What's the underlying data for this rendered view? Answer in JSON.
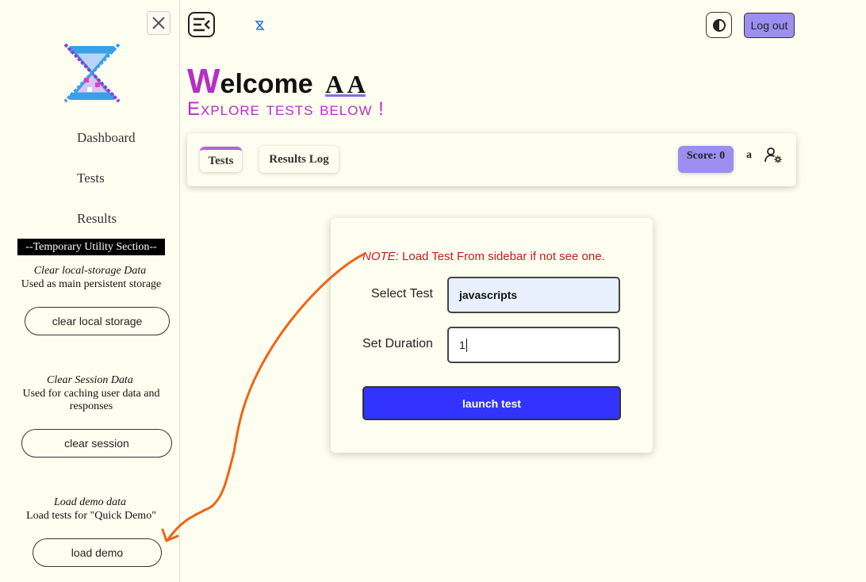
{
  "sidebar": {
    "nav": [
      {
        "label": "Dashboard"
      },
      {
        "label": "Tests"
      },
      {
        "label": "Results"
      }
    ],
    "utility_header": "--Temporary Utility Section--",
    "local_storage": {
      "title": "Clear local-storage Data",
      "desc": "Used as main persistent storage",
      "button": "clear local storage"
    },
    "session": {
      "title": "Clear Session Data",
      "desc": "Used for caching user data and responses",
      "button": "clear session"
    },
    "demo": {
      "title": "Load demo data",
      "desc": "Load tests for \"Quick Demo\"",
      "button": "load demo"
    }
  },
  "header": {
    "logout": "Log out"
  },
  "welcome": {
    "first_letter": "W",
    "rest": "elcome",
    "user": "A A",
    "subtitle": "Explore tests below !"
  },
  "tabs": [
    {
      "label": "Tests",
      "active": true
    },
    {
      "label": "Results Log",
      "active": false
    }
  ],
  "score": "Score: 0",
  "user_initial": "a",
  "form": {
    "note_prefix": "NOTE:",
    "note_text": " Load Test From sidebar if not see one.",
    "select_label": "Select Test",
    "select_value": "javascripts",
    "duration_label": "Set Duration",
    "duration_value": "1",
    "launch": "launch test"
  },
  "colors": {
    "accent_purple": "#b62fc4",
    "lavender": "#9d8ef2",
    "launch_blue": "#3333ff",
    "note_red": "#c51b1b",
    "arrow_orange": "#f06414"
  },
  "icons": [
    "close-icon",
    "app-logo-icon",
    "sidebar-collapse-icon",
    "theme-toggle-icon",
    "user-settings-icon"
  ]
}
